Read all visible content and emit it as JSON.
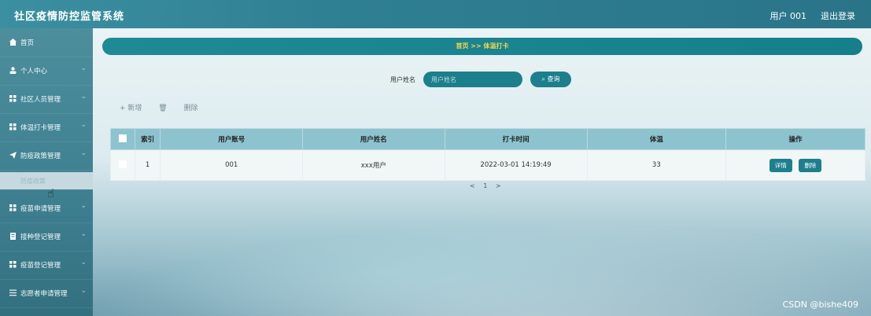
{
  "header": {
    "app_title": "社区疫情防控监管系统",
    "user_label": "用户 001",
    "logout_label": "退出登录"
  },
  "sidebar": {
    "items": [
      {
        "label": "首页",
        "icon": "home-icon"
      },
      {
        "label": "个人中心",
        "icon": "user-icon"
      },
      {
        "label": "社区人员管理",
        "icon": "grid-icon"
      },
      {
        "label": "体温打卡管理",
        "icon": "grid-icon"
      },
      {
        "label": "防疫政策管理",
        "icon": "send-icon"
      },
      {
        "label": "疫苗申请管理",
        "icon": "grid-icon"
      },
      {
        "label": "接种登记管理",
        "icon": "doc-icon"
      },
      {
        "label": "疫苗登记管理",
        "icon": "grid-icon"
      },
      {
        "label": "志愿者申请管理",
        "icon": "list-icon"
      }
    ],
    "subitem": {
      "label": "防疫政策"
    }
  },
  "breadcrumb": "首页 >> 体温打卡",
  "search": {
    "label": "用户姓名",
    "placeholder": "用户姓名",
    "button": "查询"
  },
  "toolbar": {
    "add": "+ 新增",
    "delete": "删除"
  },
  "table": {
    "headers": [
      "索引",
      "用户账号",
      "用户姓名",
      "打卡时间",
      "体温",
      "操作"
    ],
    "rows": [
      {
        "index": "1",
        "account": "001",
        "name": "xxx用户",
        "time": "2022-03-01 14:19:49",
        "temp": "33"
      }
    ],
    "actions": {
      "detail": "详情",
      "delete": "删除"
    }
  },
  "pager": {
    "prev": "<",
    "page": "1",
    "next": ">"
  },
  "watermark": "CSDN @bishe409",
  "colors": {
    "accent": "#1c7f8c",
    "breadcrumb_text": "#f7d64a"
  }
}
